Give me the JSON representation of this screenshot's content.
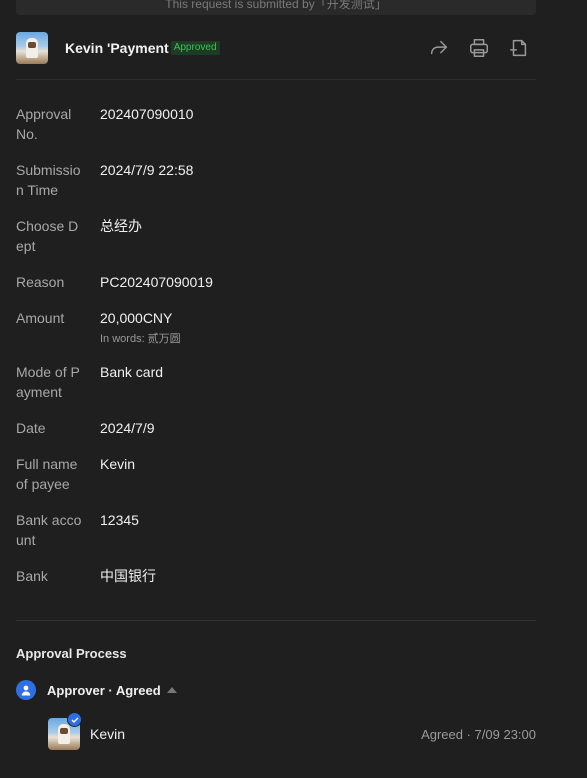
{
  "top_banner": "This request is submitted by「开发测试」",
  "header": {
    "title": "Kevin 'Payment",
    "status_badge": "Approved",
    "icons": [
      "share-icon",
      "print-icon",
      "export-icon"
    ]
  },
  "fields": [
    {
      "label": "Approval No.",
      "value": "202407090010"
    },
    {
      "label": "Submission Time",
      "value": "2024/7/9 22:58"
    },
    {
      "label": "Choose Dept",
      "value": "总经办"
    },
    {
      "label": "Reason",
      "value": "PC202407090019"
    },
    {
      "label": "Amount",
      "value": "20,000CNY",
      "sub": "In words: 贰万圆"
    },
    {
      "label": "Mode of Payment",
      "value": "Bank card"
    },
    {
      "label": "Date",
      "value": "2024/7/9"
    },
    {
      "label": "Full name of payee",
      "value": "Kevin"
    },
    {
      "label": "Bank account",
      "value": "12345"
    },
    {
      "label": "Bank",
      "value": "中国银行"
    }
  ],
  "process": {
    "title": "Approval Process",
    "step_label": "Approver · Agreed",
    "approver_name": "Kevin",
    "approver_status": "Agreed · 7/09 23:00"
  },
  "colors": {
    "accent": "#2f6fe6",
    "approved": "#32c850",
    "background": "#1f1f1f"
  }
}
